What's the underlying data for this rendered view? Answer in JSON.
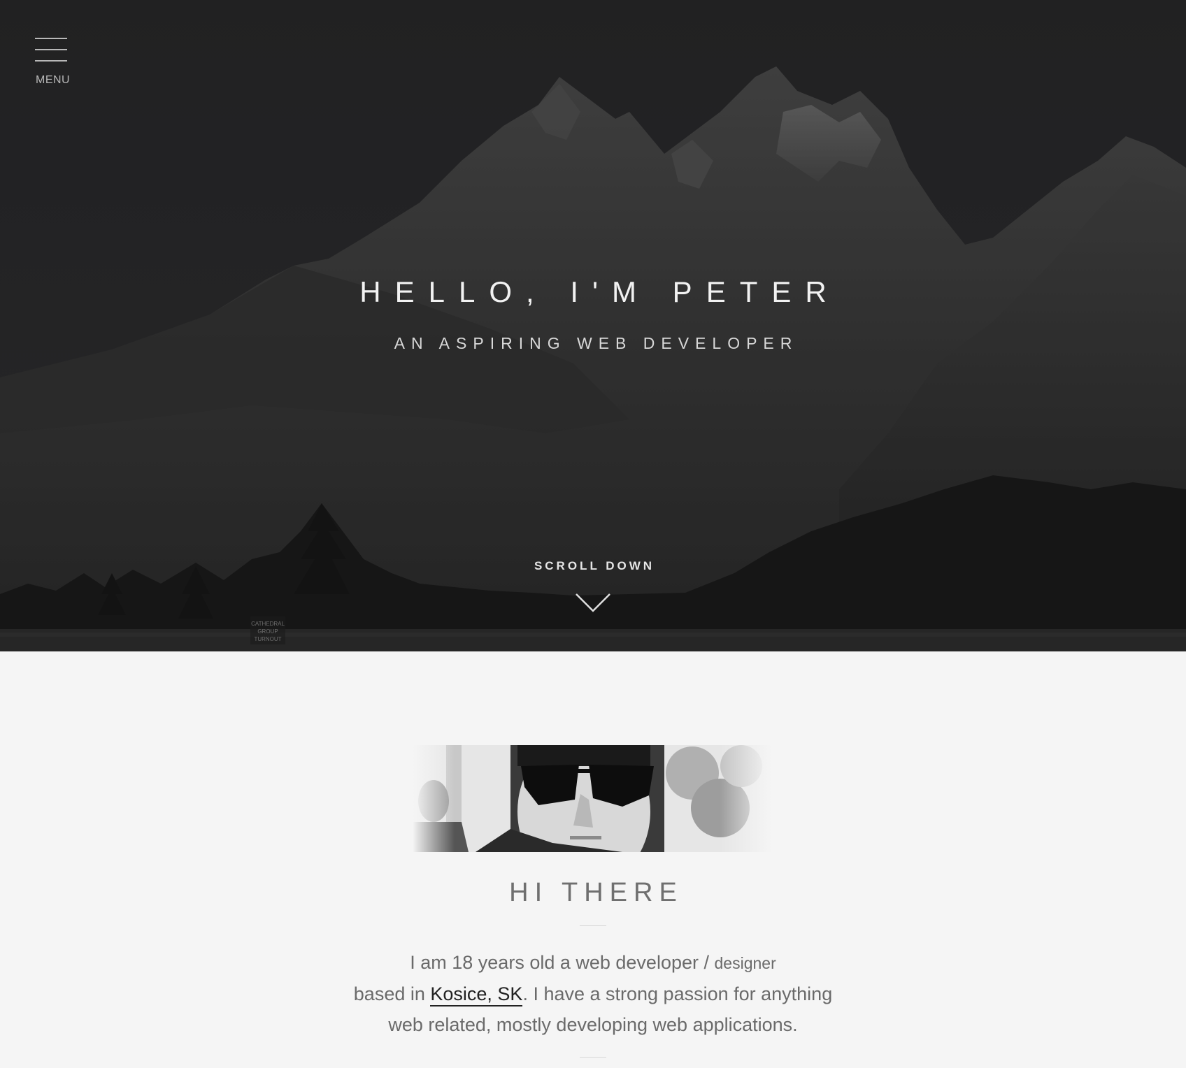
{
  "nav": {
    "menu_label": "MENU"
  },
  "hero": {
    "title": "HELLO, I'M PETER",
    "subtitle": "AN ASPIRING WEB DEVELOPER",
    "scroll_label": "SCROLL DOWN",
    "sign_text": [
      "CATHEDRAL",
      "GROUP",
      "TURNOUT"
    ]
  },
  "about": {
    "heading": "HI THERE",
    "text_1": "I am 18 years old a web developer / ",
    "text_1_small": "designer",
    "text_2": "based in ",
    "location_link": "Kosice, SK",
    "text_3": ". I have a strong passion for anything",
    "text_4": "web related, mostly developing web applications."
  },
  "colors": {
    "hero_overlay": "#222224",
    "page_background": "#f5f5f5",
    "heading_text": "#6f6f6f",
    "link": "#222222"
  }
}
